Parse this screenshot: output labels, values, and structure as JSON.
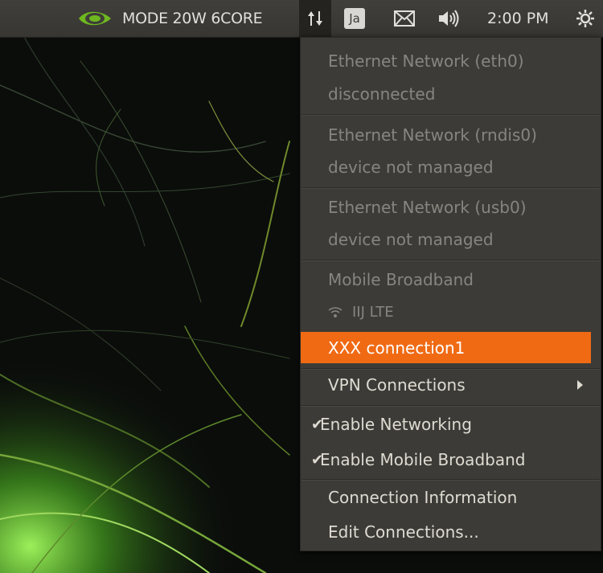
{
  "panel": {
    "mode_label": "MODE 20W 6CORE",
    "ja_label": "Ja",
    "clock": "2:00 PM",
    "icons": [
      "nvidia-logo-icon",
      "network-updown-icon",
      "mail-icon",
      "volume-icon",
      "power-icon"
    ]
  },
  "menu": {
    "eth0_title": "Ethernet Network (eth0)",
    "eth0_status": "disconnected",
    "rndis0_title": "Ethernet Network (rndis0)",
    "rndis0_status": "device not managed",
    "usb0_title": "Ethernet Network (usb0)",
    "usb0_status": "device not managed",
    "mobile_title": "Mobile Broadband",
    "mobile_conn": "IIJ LTE",
    "selected_conn": "XXX connection1",
    "vpn": "VPN Connections",
    "enable_networking": "Enable Networking",
    "enable_mobile": "Enable Mobile Broadband",
    "conn_info": "Connection Information",
    "edit_conn": "Edit Connections...",
    "check_mark": "✔"
  },
  "colors": {
    "panel": "#3c3b37",
    "menu": "#3c3b37",
    "accent": "#f06a14",
    "dim_text": "#86857f"
  }
}
